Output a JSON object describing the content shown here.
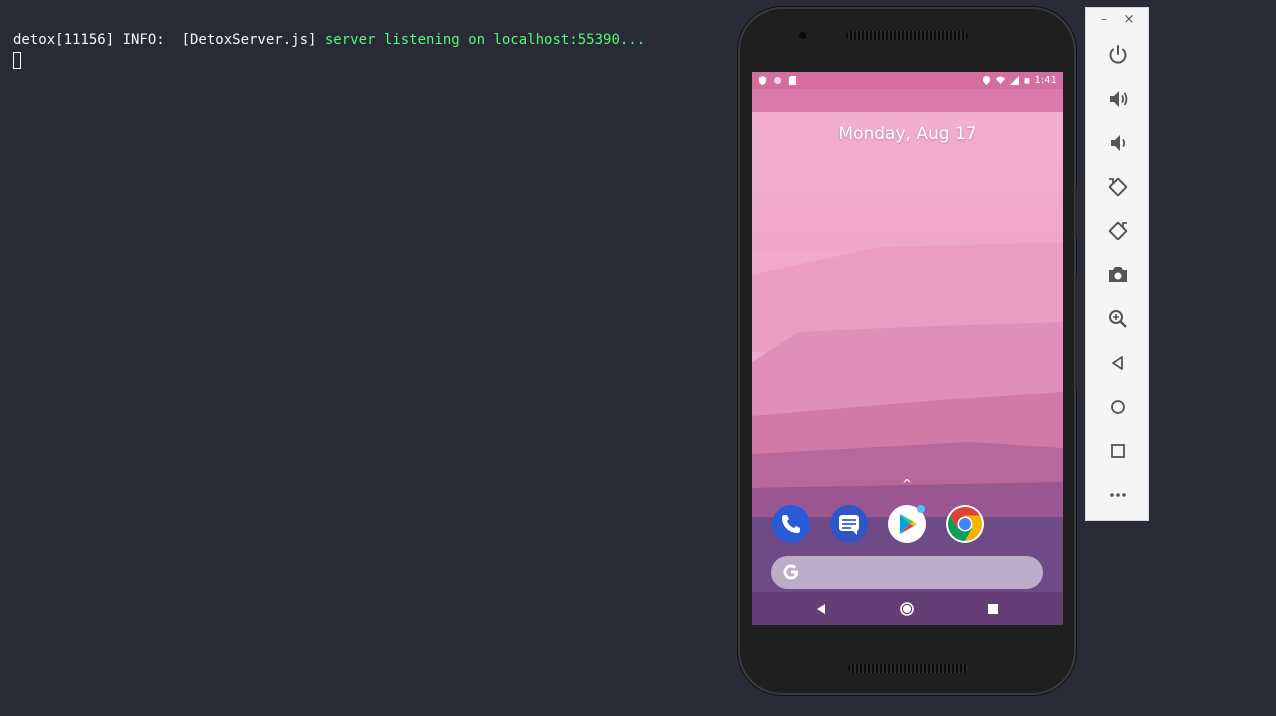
{
  "terminal": {
    "prefix": "detox[11156] INFO:  [DetoxServer.js] ",
    "message": "server listening on localhost:55390..."
  },
  "phone": {
    "statusbar": {
      "left_icons": [
        "shield-icon",
        "circle-icon",
        "sd-card-icon"
      ],
      "right_icons": [
        "location-icon",
        "wifi-icon",
        "signal-icon",
        "battery-icon"
      ],
      "time": "1:41"
    },
    "date": "Monday, Aug 17",
    "app_drawer_hint": "^",
    "dock_apps": [
      {
        "name": "Phone",
        "icon": "phone-icon"
      },
      {
        "name": "Messages",
        "icon": "messages-icon"
      },
      {
        "name": "Play Store",
        "icon": "play-store-icon"
      },
      {
        "name": "Chrome",
        "icon": "chrome-icon"
      }
    ],
    "search": {
      "icon": "google-g-icon"
    },
    "nav": [
      "back-icon",
      "home-icon",
      "recents-icon"
    ]
  },
  "toolbar": {
    "window_controls": [
      "–",
      "×"
    ],
    "buttons": [
      {
        "name": "power",
        "icon": "power-icon"
      },
      {
        "name": "volume-up",
        "icon": "volume-up-icon"
      },
      {
        "name": "volume-down",
        "icon": "volume-down-icon"
      },
      {
        "name": "rotate-left",
        "icon": "rotate-left-icon"
      },
      {
        "name": "rotate-right",
        "icon": "rotate-right-icon"
      },
      {
        "name": "screenshot",
        "icon": "camera-icon"
      },
      {
        "name": "zoom",
        "icon": "zoom-icon"
      },
      {
        "name": "back",
        "icon": "back-icon"
      },
      {
        "name": "home",
        "icon": "home-icon"
      },
      {
        "name": "overview",
        "icon": "overview-icon"
      },
      {
        "name": "more",
        "icon": "more-icon"
      }
    ]
  },
  "colors": {
    "terminal_bg": "#282a36",
    "terminal_text": "#f8f8f2",
    "terminal_green": "#50fa7b",
    "wallpaper_top": "#f0a8cc",
    "wallpaper_bottom": "#6e4a86"
  }
}
